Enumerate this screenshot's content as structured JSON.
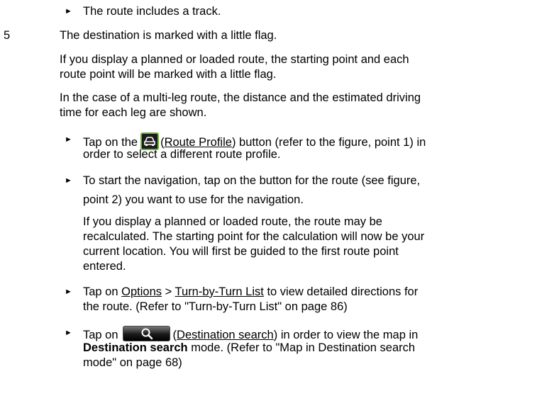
{
  "bullets": {
    "l1": "The route includes a track.",
    "l7": "Tap on the",
    "l7_link": "Route Profile",
    "l7_rest": "button (refer to the figure, point 1) in",
    "l8": "order to select a different route profile.",
    "l9": "To start the navigation, tap on the button for the route (see figure,",
    "l10": "point 2) you want to use for the navigation.",
    "l15": "Tap on",
    "l15_opt": "Options",
    "l15_gt": ">",
    "l15_tbt": "Turn-by-Turn List",
    "l15_rest": "to view detailed directions for",
    "l16": "the route. (Refer to \"Turn-by-Turn List\" on page 86)",
    "l17": "Tap on",
    "l17_link": "Destination search",
    "l17_rest": "in order to view the map in",
    "l18_bold": "Destination search",
    "l18_rest": "mode. (Refer to \"Map in Destination search",
    "l19": "mode\" on page 68)"
  },
  "numbered": {
    "n": "5",
    "l2": "The destination is marked with a little flag.",
    "l3": "If you display a planned or loaded route, the starting point and each",
    "l4": "route point will be marked with a little flag.",
    "l5": "In the case of a multi-leg route, the distance and the estimated driving",
    "l6": "time for each leg are shown."
  },
  "para": {
    "l11": "If you display a planned or loaded route, the route may be",
    "l12": "recalculated. The starting point for the calculation will now be your",
    "l13": "current location. You will first be guided to the first route point",
    "l14": "entered."
  },
  "bullet_char": "►"
}
